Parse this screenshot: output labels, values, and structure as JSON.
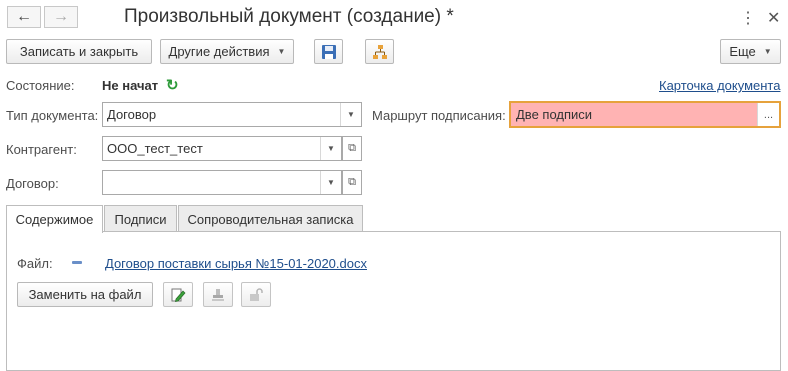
{
  "window": {
    "title": "Произвольный документ (создание) *",
    "back_icon": "back-arrow-icon",
    "forward_icon": "forward-arrow-icon",
    "more_icon": "more-vertical-icon",
    "close_icon": "close-icon"
  },
  "toolbar": {
    "save_close_label": "Записать и закрыть",
    "other_actions_label": "Другие действия",
    "more_label": "Еще",
    "save_icon": "floppy-disk-icon",
    "structure_icon": "hierarchy-icon"
  },
  "status": {
    "label": "Состояние:",
    "value": "Не начат",
    "refresh_icon": "refresh-icon",
    "card_link": "Карточка документа"
  },
  "fields": {
    "doc_type_label": "Тип документа:",
    "doc_type_value": "Договор",
    "route_label": "Маршрут подписания:",
    "route_value": "Две подписи",
    "route_select_label": "...",
    "counterparty_label": "Контрагент:",
    "counterparty_value": "ООО_тест_тест",
    "contract_label": "Договор:",
    "contract_value": ""
  },
  "tabs": [
    {
      "label": "Содержимое",
      "active": true
    },
    {
      "label": "Подписи",
      "active": false
    },
    {
      "label": "Сопроводительная записка",
      "active": false
    }
  ],
  "content": {
    "file_label": "Файл:",
    "file_link": "Договор поставки сырья №15-01-2020.docx",
    "replace_button": "Заменить на файл",
    "edit_icon": "edit-document-icon",
    "sign_icon": "stamp-icon",
    "lock_icon": "unlock-icon"
  },
  "colors": {
    "route_field_bg": "#ffb3b3",
    "route_field_border": "#e6a23c",
    "status_icon": "#2e9b3a",
    "link": "#1f4e8c"
  }
}
